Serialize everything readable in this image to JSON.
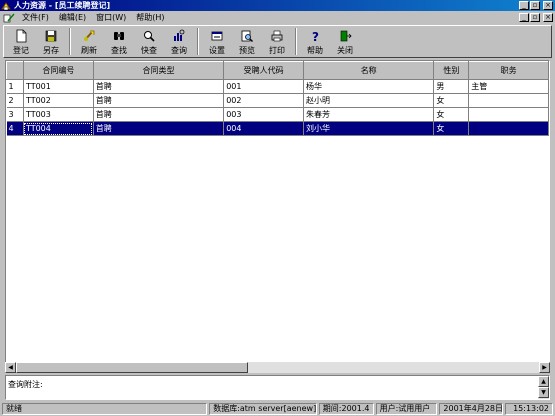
{
  "window": {
    "title": "人力资源 - [员工续聘登记]"
  },
  "menu": {
    "items": [
      "文件(F)",
      "编辑(E)",
      "窗口(W)",
      "帮助(H)"
    ]
  },
  "toolbar": {
    "buttons": [
      {
        "label": "登记",
        "icon": "new-document-icon"
      },
      {
        "label": "另存",
        "icon": "save-icon"
      },
      {
        "label": "刷新",
        "icon": "refresh-icon"
      },
      {
        "label": "查找",
        "icon": "binoculars-icon"
      },
      {
        "label": "快查",
        "icon": "quick-search-icon"
      },
      {
        "label": "查询",
        "icon": "query-icon"
      },
      {
        "label": "设置",
        "icon": "settings-icon"
      },
      {
        "label": "预览",
        "icon": "preview-icon"
      },
      {
        "label": "打印",
        "icon": "printer-icon"
      },
      {
        "label": "帮助",
        "icon": "help-icon"
      },
      {
        "label": "关闭",
        "icon": "exit-door-icon"
      }
    ]
  },
  "grid": {
    "columns": [
      "合同编号",
      "合同类型",
      "受聘人代码",
      "名称",
      "性别",
      "职务"
    ],
    "rows": [
      {
        "num": "1",
        "contract_no": "TT001",
        "type": "首聘",
        "code": "001",
        "name": "杨华",
        "gender": "男",
        "position": "主管"
      },
      {
        "num": "2",
        "contract_no": "TT002",
        "type": "首聘",
        "code": "002",
        "name": "赵小明",
        "gender": "女",
        "position": ""
      },
      {
        "num": "3",
        "contract_no": "TT003",
        "type": "首聘",
        "code": "003",
        "name": "朱春芳",
        "gender": "女",
        "position": ""
      },
      {
        "num": "4",
        "contract_no": "TT004",
        "type": "首聘",
        "code": "004",
        "name": "刘小华",
        "gender": "女",
        "position": ""
      }
    ],
    "selected_row": 4
  },
  "notes": {
    "label": "查询附注:"
  },
  "status": {
    "ready": "就绪",
    "database": "数据库:atm server[aenew]",
    "period": "期间:2001.4",
    "user": "用户:试用用户",
    "date": "2001年4月28日",
    "time": "15:13:02"
  },
  "colors": {
    "title_start": "#000080",
    "title_end": "#1084d0",
    "selection": "#000080",
    "face": "#c0c0c0"
  }
}
